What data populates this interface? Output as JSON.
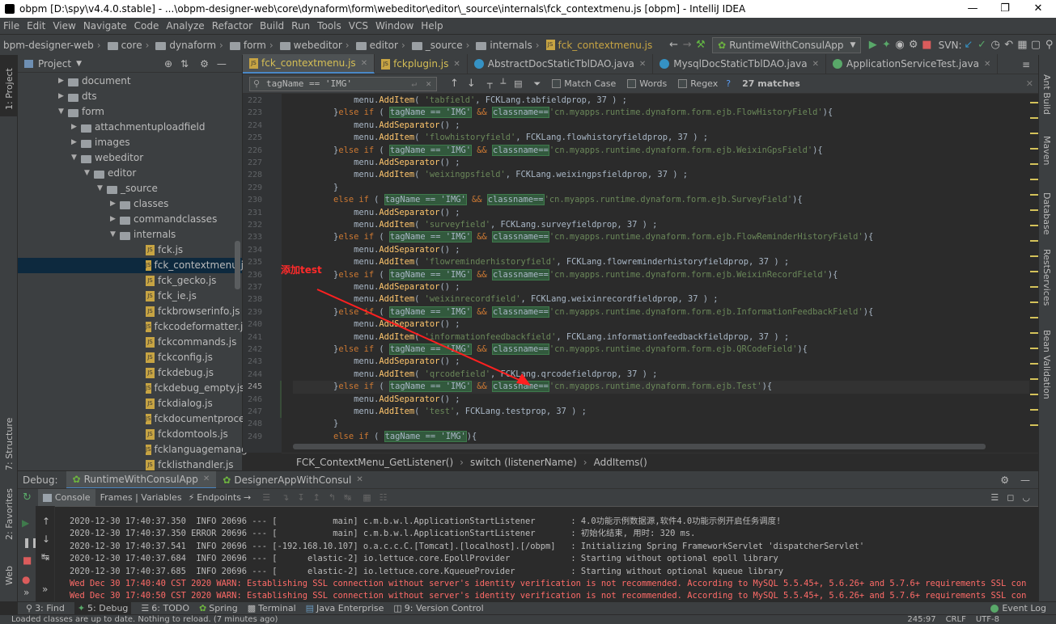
{
  "window": {
    "title": "obpm [D:\\spy\\v4.4.0.stable] - ...\\obpm-designer-web\\core\\dynaform\\form\\webeditor\\editor\\_source\\internals\\fck_contextmenu.js [obpm] - IntelliJ IDEA"
  },
  "menu": [
    "File",
    "Edit",
    "View",
    "Navigate",
    "Code",
    "Analyze",
    "Refactor",
    "Build",
    "Run",
    "Tools",
    "VCS",
    "Window",
    "Help"
  ],
  "breadcrumb": [
    "bpm-designer-web",
    "core",
    "dynaform",
    "form",
    "webeditor",
    "editor",
    "_source",
    "internals",
    "fck_contextmenu.js"
  ],
  "toolbar": {
    "run_config": "RuntimeWithConsulApp",
    "svn_label": "SVN:"
  },
  "left_strip": {
    "project": "1: Project",
    "structure": "7: Structure",
    "favorites": "2: Favorites",
    "web": "Web"
  },
  "right_strip": {
    "ant": "Ant Build",
    "maven": "Maven",
    "database": "Database",
    "rest": "RestServices",
    "bean": "Bean Validation"
  },
  "project": {
    "title": "Project",
    "tree": [
      {
        "label": "document",
        "type": "folder",
        "indent": 0,
        "arrow": "right"
      },
      {
        "label": "dts",
        "type": "folder",
        "indent": 0,
        "arrow": "right"
      },
      {
        "label": "form",
        "type": "folder",
        "indent": 0,
        "arrow": "down"
      },
      {
        "label": "attachmentuploadfield",
        "type": "folder",
        "indent": 1,
        "arrow": "right"
      },
      {
        "label": "images",
        "type": "folder",
        "indent": 1,
        "arrow": "right"
      },
      {
        "label": "webeditor",
        "type": "folder",
        "indent": 1,
        "arrow": "down"
      },
      {
        "label": "editor",
        "type": "folder",
        "indent": 2,
        "arrow": "down"
      },
      {
        "label": "_source",
        "type": "folder",
        "indent": 3,
        "arrow": "down"
      },
      {
        "label": "classes",
        "type": "folder",
        "indent": 4,
        "arrow": "right"
      },
      {
        "label": "commandclasses",
        "type": "folder",
        "indent": 4,
        "arrow": "right"
      },
      {
        "label": "internals",
        "type": "folder",
        "indent": 4,
        "arrow": "down"
      },
      {
        "label": "fck.js",
        "type": "js",
        "indent": 5
      },
      {
        "label": "fck_contextmenu.js",
        "type": "js",
        "indent": 5,
        "selected": true
      },
      {
        "label": "fck_gecko.js",
        "type": "js",
        "indent": 5
      },
      {
        "label": "fck_ie.js",
        "type": "js",
        "indent": 5
      },
      {
        "label": "fckbrowserinfo.js",
        "type": "js",
        "indent": 5
      },
      {
        "label": "fckcodeformatter.js",
        "type": "js",
        "indent": 5
      },
      {
        "label": "fckcommands.js",
        "type": "js",
        "indent": 5
      },
      {
        "label": "fckconfig.js",
        "type": "js",
        "indent": 5
      },
      {
        "label": "fckdebug.js",
        "type": "js",
        "indent": 5
      },
      {
        "label": "fckdebug_empty.js",
        "type": "js",
        "indent": 5
      },
      {
        "label": "fckdialog.js",
        "type": "js",
        "indent": 5
      },
      {
        "label": "fckdocumentprocessor",
        "type": "js",
        "indent": 5
      },
      {
        "label": "fckdomtools.js",
        "type": "js",
        "indent": 5
      },
      {
        "label": "fcklanguagemanager.",
        "type": "js",
        "indent": 5
      },
      {
        "label": "fcklisthandler.js",
        "type": "js",
        "indent": 5
      }
    ]
  },
  "tabs": [
    {
      "label": "fck_contextmenu.js",
      "kind": "js",
      "active": true
    },
    {
      "label": "fckplugin.js",
      "kind": "js"
    },
    {
      "label": "AbstractDocStaticTblDAO.java",
      "kind": "class"
    },
    {
      "label": "MysqlDocStaticTblDAO.java",
      "kind": "class"
    },
    {
      "label": "ApplicationServiceTest.java",
      "kind": "test"
    }
  ],
  "find": {
    "query": "tagName == 'IMG'",
    "match_case": "Match Case",
    "words": "Words",
    "regex": "Regex",
    "help": "?",
    "matches": "27 matches"
  },
  "code": {
    "line_numbers": [
      "222",
      "223",
      "224",
      "225",
      "226",
      "227",
      "228",
      "229",
      "230",
      "231",
      "232",
      "233",
      "234",
      "235",
      "236",
      "237",
      "238",
      "239",
      "240",
      "241",
      "242",
      "243",
      "244",
      "245",
      "246",
      "247",
      "248",
      "249"
    ],
    "lines": [
      [
        [
          "",
          "            menu."
        ],
        [
          "fn",
          "AddItem"
        ],
        [
          "",
          "( "
        ],
        [
          "st",
          "'tabfield'"
        ],
        [
          "",
          ", FCKLang.tabfieldprop, 37 ) ;"
        ]
      ],
      [
        [
          "",
          "        }"
        ],
        [
          "kw",
          "else if"
        ],
        [
          "",
          " ( "
        ],
        [
          "hl",
          "tagName == 'IMG'"
        ],
        [
          "kw",
          " && "
        ],
        [
          "hl",
          "classname=="
        ],
        [
          "st",
          "'cn.myapps.runtime.dynaform.form.ejb.FlowHistoryField'"
        ],
        [
          "",
          ")"
        ],
        [
          "",
          "{"
        ]
      ],
      [
        [
          "",
          "            menu."
        ],
        [
          "fn",
          "AddSeparator"
        ],
        [
          "",
          "() ;"
        ]
      ],
      [
        [
          "",
          "            menu."
        ],
        [
          "fn",
          "AddItem"
        ],
        [
          "",
          "( "
        ],
        [
          "st",
          "'flowhistoryfield'"
        ],
        [
          "",
          ", FCKLang.flowhistoryfieldprop, 37 ) ;"
        ]
      ],
      [
        [
          "",
          "        }"
        ],
        [
          "kw",
          "else if"
        ],
        [
          "",
          " ( "
        ],
        [
          "hl",
          "tagName == 'IMG'"
        ],
        [
          "kw",
          " && "
        ],
        [
          "hl",
          "classname=="
        ],
        [
          "st",
          "'cn.myapps.runtime.dynaform.form.ejb.WeixinGpsField'"
        ],
        [
          "",
          "){"
        ]
      ],
      [
        [
          "",
          "            menu."
        ],
        [
          "fn",
          "AddSeparator"
        ],
        [
          "",
          "() ;"
        ]
      ],
      [
        [
          "",
          "            menu."
        ],
        [
          "fn",
          "AddItem"
        ],
        [
          "",
          "( "
        ],
        [
          "st",
          "'weixingpsfield'"
        ],
        [
          "",
          ", FCKLang.weixingpsfieldprop, 37 ) ;"
        ]
      ],
      [
        [
          "",
          "        }"
        ]
      ],
      [
        [
          "",
          "        "
        ],
        [
          "kw",
          "else if"
        ],
        [
          "",
          " ( "
        ],
        [
          "hl",
          "tagName == 'IMG'"
        ],
        [
          "kw",
          " && "
        ],
        [
          "hl",
          "classname=="
        ],
        [
          "st",
          "'cn.myapps.runtime.dynaform.form.ejb.SurveyField'"
        ],
        [
          "",
          "){"
        ]
      ],
      [
        [
          "",
          "            menu."
        ],
        [
          "fn",
          "AddSeparator"
        ],
        [
          "",
          "() ;"
        ]
      ],
      [
        [
          "",
          "            menu."
        ],
        [
          "fn",
          "AddItem"
        ],
        [
          "",
          "( "
        ],
        [
          "st",
          "'surveyfield'"
        ],
        [
          "",
          ", FCKLang.surveyfieldprop, 37 ) ;"
        ]
      ],
      [
        [
          "",
          "        }"
        ],
        [
          "kw",
          "else if"
        ],
        [
          "",
          " ( "
        ],
        [
          "hl",
          "tagName == 'IMG'"
        ],
        [
          "kw",
          " && "
        ],
        [
          "hl",
          "classname=="
        ],
        [
          "st",
          "'cn.myapps.runtime.dynaform.form.ejb.FlowReminderHistoryField'"
        ],
        [
          "",
          "){"
        ]
      ],
      [
        [
          "",
          "            menu."
        ],
        [
          "fn",
          "AddSeparator"
        ],
        [
          "",
          "() ;"
        ]
      ],
      [
        [
          "",
          "            menu."
        ],
        [
          "fn",
          "AddItem"
        ],
        [
          "",
          "( "
        ],
        [
          "st",
          "'flowreminderhistoryfield'"
        ],
        [
          "",
          ", FCKLang.flowreminderhistoryfieldprop, 37 ) ;"
        ]
      ],
      [
        [
          "",
          "        }"
        ],
        [
          "kw",
          "else if"
        ],
        [
          "",
          " ( "
        ],
        [
          "hl",
          "tagName == 'IMG'"
        ],
        [
          "kw",
          " && "
        ],
        [
          "hl",
          "classname=="
        ],
        [
          "st",
          "'cn.myapps.runtime.dynaform.form.ejb.WeixinRecordField'"
        ],
        [
          "",
          "){"
        ]
      ],
      [
        [
          "",
          "            menu."
        ],
        [
          "fn",
          "AddSeparator"
        ],
        [
          "",
          "() ;"
        ]
      ],
      [
        [
          "",
          "            menu."
        ],
        [
          "fn",
          "AddItem"
        ],
        [
          "",
          "( "
        ],
        [
          "st",
          "'weixinrecordfield'"
        ],
        [
          "",
          ", FCKLang.weixinrecordfieldprop, 37 ) ;"
        ]
      ],
      [
        [
          "",
          "        }"
        ],
        [
          "kw",
          "else if"
        ],
        [
          "",
          " ( "
        ],
        [
          "hl",
          "tagName == 'IMG'"
        ],
        [
          "kw",
          " && "
        ],
        [
          "hl",
          "classname=="
        ],
        [
          "st",
          "'cn.myapps.runtime.dynaform.form.ejb.InformationFeedbackField'"
        ],
        [
          "",
          "){"
        ]
      ],
      [
        [
          "",
          "            menu."
        ],
        [
          "fn",
          "AddSeparator"
        ],
        [
          "",
          "() ;"
        ]
      ],
      [
        [
          "",
          "            menu."
        ],
        [
          "fn",
          "AddItem"
        ],
        [
          "",
          "( "
        ],
        [
          "st",
          "'informationfeedbackfield'"
        ],
        [
          "",
          ", FCKLang.informationfeedbackfieldprop, 37 ) ;"
        ]
      ],
      [
        [
          "",
          "        }"
        ],
        [
          "kw",
          "else if"
        ],
        [
          "",
          " ( "
        ],
        [
          "hl",
          "tagName == 'IMG'"
        ],
        [
          "kw",
          " && "
        ],
        [
          "hl",
          "classname=="
        ],
        [
          "st",
          "'cn.myapps.runtime.dynaform.form.ejb.QRCodeField'"
        ],
        [
          "",
          "){"
        ]
      ],
      [
        [
          "",
          "            menu."
        ],
        [
          "fn",
          "AddSeparator"
        ],
        [
          "",
          "() ;"
        ]
      ],
      [
        [
          "",
          "            menu."
        ],
        [
          "fn",
          "AddItem"
        ],
        [
          "",
          "( "
        ],
        [
          "st",
          "'qrcodefield'"
        ],
        [
          "",
          ", FCKLang.qrcodefieldprop, 37 ) ;"
        ]
      ],
      [
        [
          "",
          "        }"
        ],
        [
          "kw",
          "else if"
        ],
        [
          "",
          " ( "
        ],
        [
          "hl",
          "tagName == 'IMG'"
        ],
        [
          "kw",
          " && "
        ],
        [
          "hl",
          "classname=="
        ],
        [
          "st",
          "'cn.myapps.runtime.dynaform.form.ejb.Test'"
        ],
        [
          "",
          "){"
        ]
      ],
      [
        [
          "",
          "            menu."
        ],
        [
          "fn",
          "AddSeparator"
        ],
        [
          "",
          "() ;"
        ]
      ],
      [
        [
          "",
          "            menu."
        ],
        [
          "fn",
          "AddItem"
        ],
        [
          "",
          "( "
        ],
        [
          "st",
          "'test'"
        ],
        [
          "",
          ", FCKLang.testprop, 37 ) ;"
        ]
      ],
      [
        [
          "",
          "        }"
        ]
      ],
      [
        [
          "",
          "        "
        ],
        [
          "kw",
          "else if"
        ],
        [
          "",
          " ( "
        ],
        [
          "hl",
          "tagName == 'IMG'"
        ],
        [
          "",
          "){"
        ]
      ]
    ]
  },
  "annotation": "添加test",
  "structure_path": [
    "FCK_ContextMenu_GetListener()",
    "switch (listenerName)",
    "AddItems()"
  ],
  "debug": {
    "label": "Debug:",
    "sessions": [
      "RuntimeWithConsulApp",
      "DesignerAppWithConsul"
    ],
    "tabs": [
      "Console",
      "Frames | Variables",
      "Endpoints"
    ]
  },
  "console": [
    {
      "text": "2020-12-30 17:40:37.350  INFO 20696 --- [           main] c.m.b.w.l.ApplicationStartListener       : 4.0功能示例数据源,软件4.0功能示例开启任务调度!",
      "level": "info"
    },
    {
      "text": "2020-12-30 17:40:37.350 ERROR 20696 --- [           main] c.m.b.w.l.ApplicationStartListener       : 初始化结束, 用时: 320 ms.",
      "level": "info"
    },
    {
      "text": "2020-12-30 17:40:37.541  INFO 20696 --- [-192.168.10.107] o.a.c.c.C.[Tomcat].[localhost].[/obpm]   : Initializing Spring FrameworkServlet 'dispatcherServlet'",
      "level": "info"
    },
    {
      "text": "2020-12-30 17:40:37.684  INFO 20696 --- [      elastic-2] io.lettuce.core.EpollProvider            : Starting without optional epoll library",
      "level": "info"
    },
    {
      "text": "2020-12-30 17:40:37.685  INFO 20696 --- [      elastic-2] io.lettuce.core.KqueueProvider           : Starting without optional kqueue library",
      "level": "info"
    },
    {
      "text": "Wed Dec 30 17:40:40 CST 2020 WARN: Establishing SSL connection without server's identity verification is not recommended. According to MySQL 5.5.45+, 5.6.26+ and 5.7.6+ requirements SSL con",
      "level": "warn"
    },
    {
      "text": "Wed Dec 30 17:40:50 CST 2020 WARN: Establishing SSL connection without server's identity verification is not recommended. According to MySQL 5.5.45+, 5.6.26+ and 5.7.6+ requirements SSL con",
      "level": "warn"
    }
  ],
  "bottom_tools": [
    "3: Find",
    "5: Debug",
    "6: TODO",
    "Spring",
    "Terminal",
    "Java Enterprise",
    "9: Version Control"
  ],
  "event_log": "Event Log",
  "status": {
    "message": "Loaded classes are up to date. Nothing to reload. (7 minutes ago)",
    "position": "245:97",
    "line_sep": "CRLF",
    "encoding": "UTF-8"
  },
  "colors": {
    "accent": "#4a88c7",
    "keyword": "#cc7832",
    "string": "#6a8759",
    "function": "#ffc66d",
    "error": "#ff6b68",
    "annotation": "#ff2a2a"
  }
}
